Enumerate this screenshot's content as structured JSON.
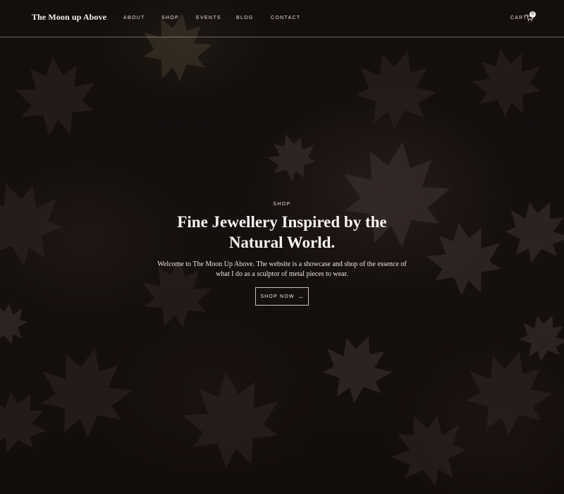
{
  "header": {
    "logo": "The Moon up Above",
    "nav": [
      {
        "label": "ABOUT"
      },
      {
        "label": "SHOP"
      },
      {
        "label": "EVENTS"
      },
      {
        "label": "BLOG"
      },
      {
        "label": "CONTACT"
      }
    ],
    "cart_label": "CART",
    "cart_count": "0",
    "cart_icon": "cart-icon"
  },
  "hero": {
    "eyebrow": "SHOP",
    "headline": "Fine Jewellery Inspired by the Natural World.",
    "intro": "Welcome to The Moon Up Above. The website is a showcase and shop of the essence of what I do as a sculptor of metal pieces to wear.",
    "cta_label": "SHOP NOW",
    "cta_arrow": "→",
    "background": "dark autumn leaves photo"
  },
  "colors": {
    "background": "#140f0d",
    "text": "#f3ede4",
    "divider": "#d8cfc2"
  }
}
